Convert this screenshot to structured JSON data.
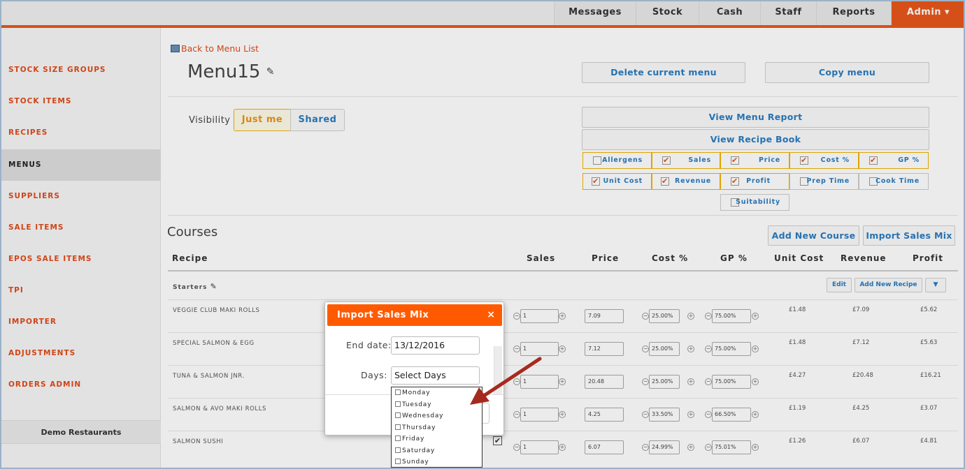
{
  "topnav": {
    "items": [
      "Messages",
      "Stock",
      "Cash",
      "Staff",
      "Reports"
    ],
    "admin": "Admin ▾"
  },
  "sidebar": {
    "items": [
      "STOCK SIZE GROUPS",
      "STOCK ITEMS",
      "RECIPES",
      "MENUS",
      "SUPPLIERS",
      "SALE ITEMS",
      "EPOS SALE ITEMS",
      "TPI",
      "IMPORTER",
      "ADJUSTMENTS",
      "ORDERS ADMIN"
    ],
    "active": "MENUS",
    "footer": "Demo Restaurants"
  },
  "menu": {
    "back_link": "Back to Menu List",
    "title": "Menu15",
    "delete_btn": "Delete current menu",
    "copy_btn": "Copy menu",
    "visibility_label": "Visibility",
    "vis_just_me": "Just me",
    "vis_shared": "Shared",
    "report_btn": "View Menu Report",
    "recipe_book_btn": "View Recipe Book"
  },
  "options": {
    "allergens": "Allergens",
    "sales": "Sales",
    "price": "Price",
    "cost_pct": "Cost %",
    "gp_pct": "GP %",
    "unit_cost": "Unit Cost",
    "revenue": "Revenue",
    "profit": "Profit",
    "prep_time": "Prep Time",
    "cook_time": "Cook Time",
    "suitability": "Suitability"
  },
  "courses": {
    "title": "Courses",
    "add_course_btn": "Add New Course",
    "import_btn": "Import Sales Mix",
    "headers": {
      "recipe": "Recipe",
      "sales": "Sales",
      "price": "Price",
      "cost": "Cost %",
      "gp": "GP %",
      "unit_cost": "Unit Cost",
      "revenue": "Revenue",
      "profit": "Profit"
    },
    "section": "Starters",
    "edit_btn": "Edit",
    "add_recipe_btn": "Add New Recipe",
    "caret": "▼",
    "rows": [
      {
        "name": "VEGGIE CLUB MAKI ROLLS",
        "sales": "1",
        "price": "7.09",
        "cost": "25.00%",
        "gp": "75.00%",
        "unit_cost": "£1.48",
        "revenue": "£7.09",
        "profit": "£5.62"
      },
      {
        "name": "SPECIAL SALMON & EGG",
        "sales": "1",
        "price": "7.12",
        "cost": "25.00%",
        "gp": "75.00%",
        "unit_cost": "£1.48",
        "revenue": "£7.12",
        "profit": "£5.63"
      },
      {
        "name": "TUNA & SALMON JNR.",
        "sales": "1",
        "price": "20.48",
        "cost": "25.00%",
        "gp": "75.00%",
        "unit_cost": "£4.27",
        "revenue": "£20.48",
        "profit": "£16.21"
      },
      {
        "name": "SALMON & AVO MAKI ROLLS",
        "sales": "1",
        "price": "4.25",
        "cost": "33.50%",
        "gp": "66.50%",
        "unit_cost": "£1.19",
        "revenue": "£4.25",
        "profit": "£3.07"
      },
      {
        "name": "SALMON SUSHI",
        "sales": "1",
        "price": "6.07",
        "cost": "24.99%",
        "gp": "75.01%",
        "unit_cost": "£1.26",
        "revenue": "£6.07",
        "profit": "£4.81"
      }
    ]
  },
  "modal": {
    "title": "Import Sales Mix",
    "close": "×",
    "end_date_label": "End date:",
    "end_date_value": "13/12/2016",
    "days_label": "Days:",
    "days_value": "Select Days",
    "day_options": [
      "Monday",
      "Tuesday",
      "Wednesday",
      "Thursday",
      "Friday",
      "Saturday",
      "Sunday"
    ]
  },
  "colors": {
    "accent": "#e8571b",
    "modal_header": "#ff5a00",
    "link_blue": "#2a7cc2",
    "option_border": "#f0b400"
  }
}
